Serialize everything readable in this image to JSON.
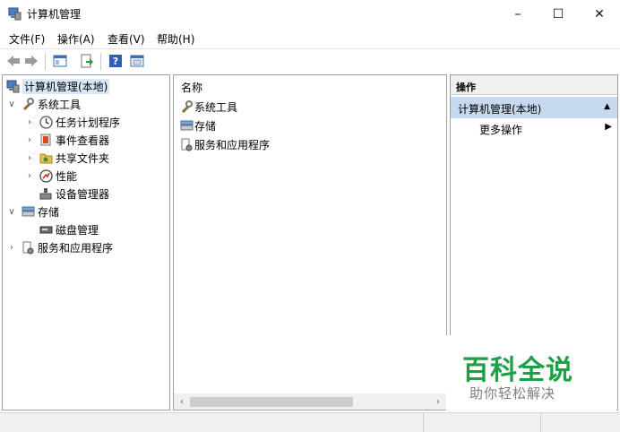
{
  "window": {
    "title": "计算机管理",
    "controls": {
      "minimize": "–",
      "maximize": "☐",
      "close": "✕"
    }
  },
  "menu": [
    "文件(F)",
    "操作(A)",
    "查看(V)",
    "帮助(H)"
  ],
  "toolbar": {
    "icons": [
      "back-icon",
      "forward-icon",
      "show-hide-tree-icon",
      "export-list-icon",
      "help-icon",
      "properties-icon"
    ]
  },
  "tree": {
    "root": "计算机管理(本地)",
    "items": [
      {
        "label": "系统工具",
        "chevron": "∨",
        "icon": "tools-icon"
      },
      {
        "label": "任务计划程序",
        "chevron": "›",
        "icon": "clock-icon"
      },
      {
        "label": "事件查看器",
        "chevron": "›",
        "icon": "event-viewer-icon"
      },
      {
        "label": "共享文件夹",
        "chevron": "›",
        "icon": "shared-folder-icon"
      },
      {
        "label": "性能",
        "chevron": "›",
        "icon": "performance-icon"
      },
      {
        "label": "设备管理器",
        "chevron": "",
        "icon": "device-manager-icon"
      },
      {
        "label": "存储",
        "chevron": "∨",
        "icon": "storage-icon"
      },
      {
        "label": "磁盘管理",
        "chevron": "",
        "icon": "disk-icon"
      },
      {
        "label": "服务和应用程序",
        "chevron": "›",
        "icon": "services-icon"
      }
    ]
  },
  "list": {
    "header": "名称",
    "items": [
      {
        "label": "系统工具",
        "icon": "tools-icon"
      },
      {
        "label": "存储",
        "icon": "storage-icon"
      },
      {
        "label": "服务和应用程序",
        "icon": "services-icon"
      }
    ],
    "scroll": {
      "left": "‹",
      "right": "›"
    }
  },
  "actions": {
    "header": "操作",
    "group": "计算机管理(本地)",
    "group_caret": "▲",
    "item": "更多操作",
    "item_arrow": "▶"
  },
  "watermark": {
    "title": "百科全说",
    "subtitle": "助你轻松解决"
  },
  "colors": {
    "selection": "#d9e8f7",
    "action_group": "#c6d9ee",
    "watermark_green": "#1aa146"
  }
}
